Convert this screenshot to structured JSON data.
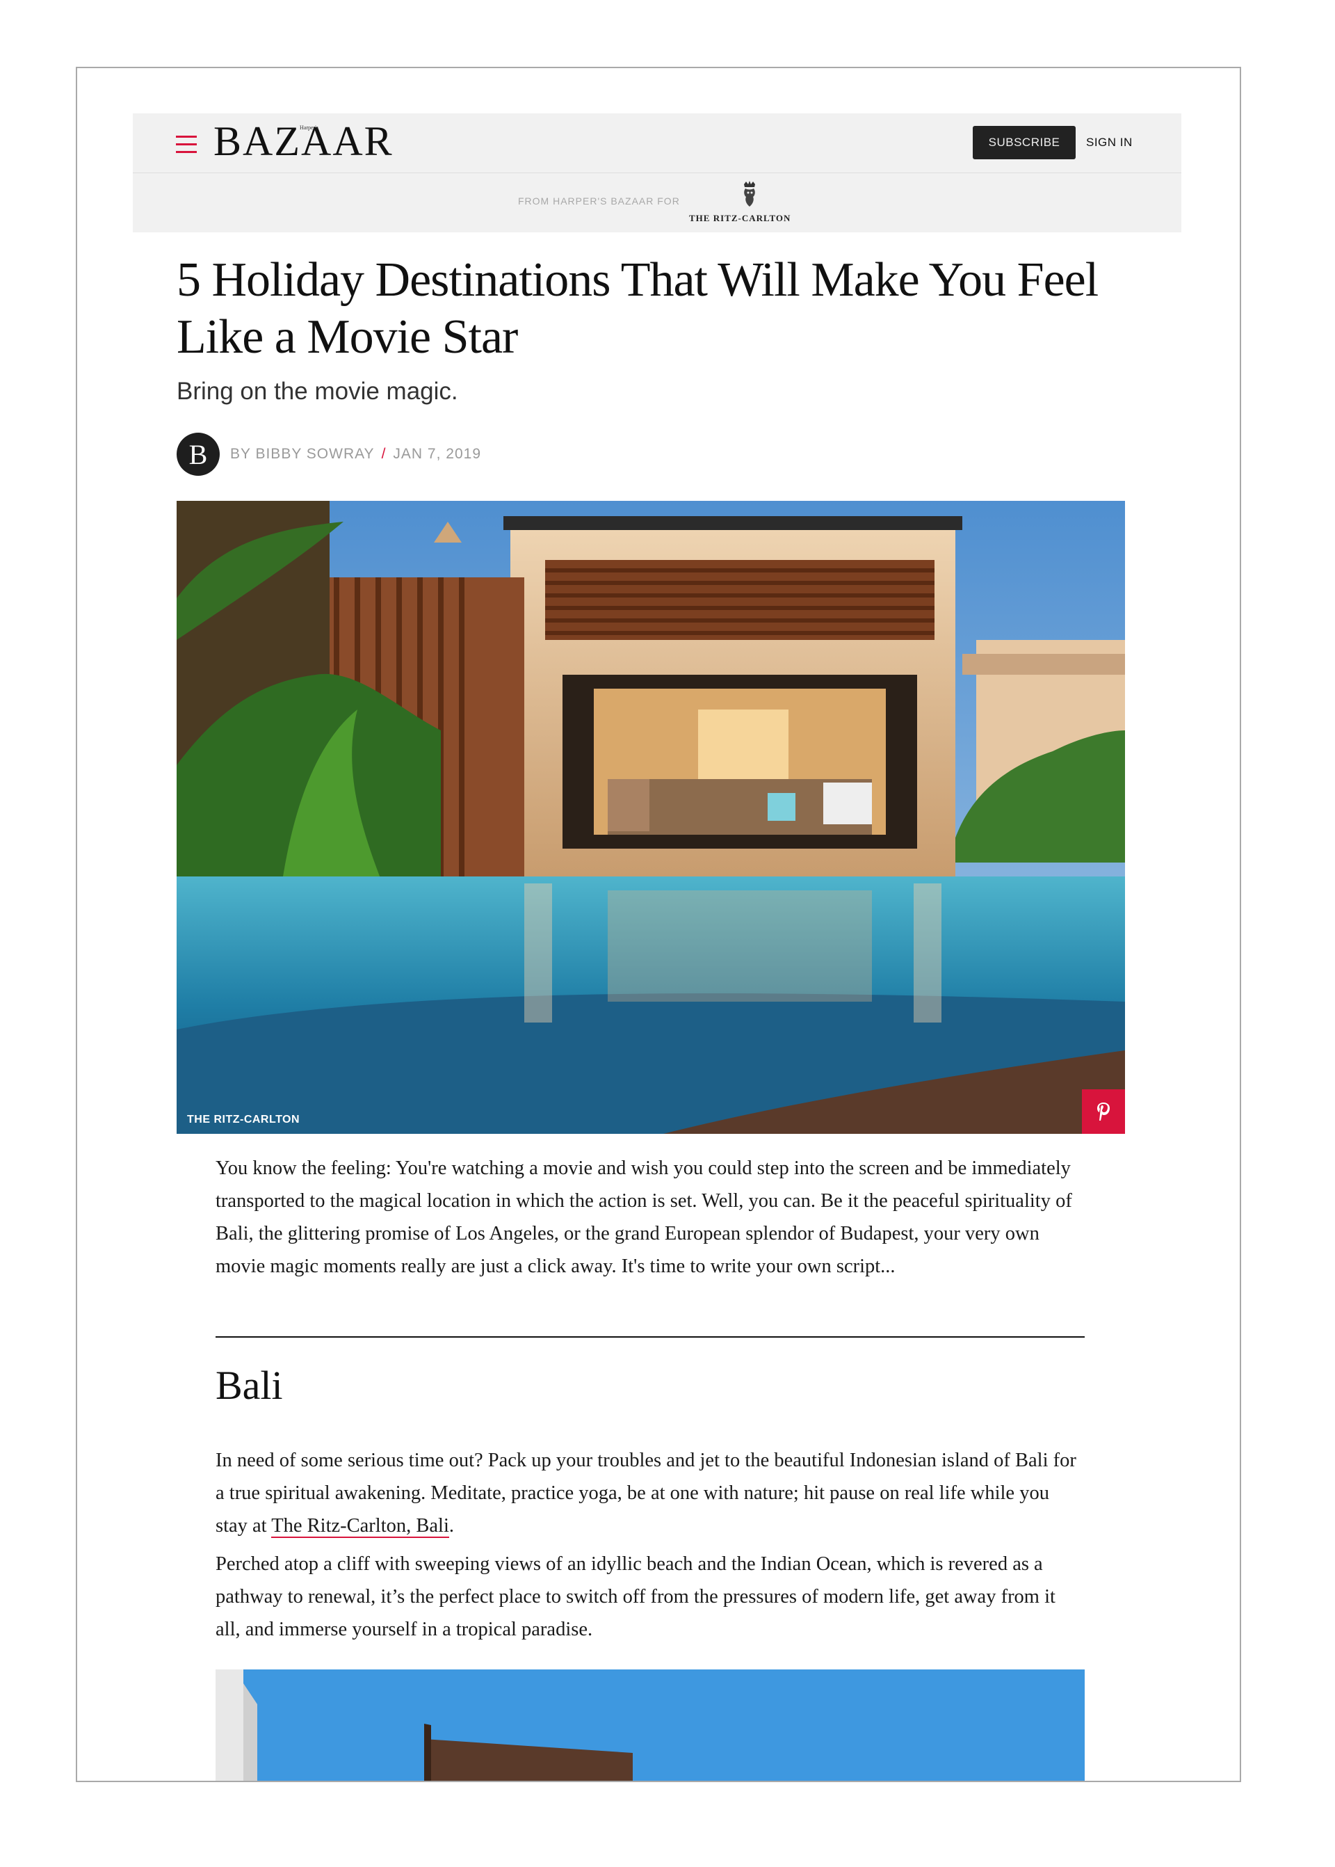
{
  "header": {
    "logo": "BAZAAR",
    "logo_small": "Harper's",
    "subscribe_label": "SUBSCRIBE",
    "signin_label": "SIGN IN",
    "sponsor_text": "FROM HARPER'S BAZAAR FOR",
    "sponsor_logo_text": "THE RITZ-CARLTON"
  },
  "article": {
    "headline": "5 Holiday Destinations That Will Make You Feel Like a Movie Star",
    "dek": "Bring on the movie magic.",
    "avatar_letter": "B",
    "author": "BY BIBBY SOWRAY",
    "separator": "/",
    "date": "JAN 7, 2019",
    "hero_credit": "THE RITZ-CARLTON",
    "intro": "You know the feeling: You're watching a movie and wish you could step into the screen and be immediately transported to the magical location in which the action is set. Well, you can. Be it the peaceful spirituality of Bali, the glittering promise of Los Angeles, or the grand European splendor of Budapest, your very own movie magic moments really are just a click away. It's time to write your own script...",
    "section_heading": "Bali",
    "bali_p1_before": "In need of some serious time out? Pack up your troubles and jet to the beautiful Indonesian island of Bali for a true spiritual awakening. Meditate, practice yoga, be at one with nature; hit pause on real life while you stay at ",
    "bali_link": "The Ritz-Carlton, Bali",
    "bali_p1_after": ".",
    "bali_p2": "Perched atop a cliff with sweeping views of an idyllic beach and the Indian Ocean, which is revered as a pathway to renewal, it’s the perfect place to switch off from the pressures of modern life, get away from it all, and immerse yourself in a tropical paradise."
  },
  "icons": {
    "menu": "hamburger-menu-icon",
    "pinterest": "pinterest-icon",
    "ritz": "ritz-carlton-lion-crown-icon"
  },
  "colors": {
    "accent": "#d8143c",
    "header_bg": "#f1f1f1",
    "button_bg": "#222222"
  }
}
